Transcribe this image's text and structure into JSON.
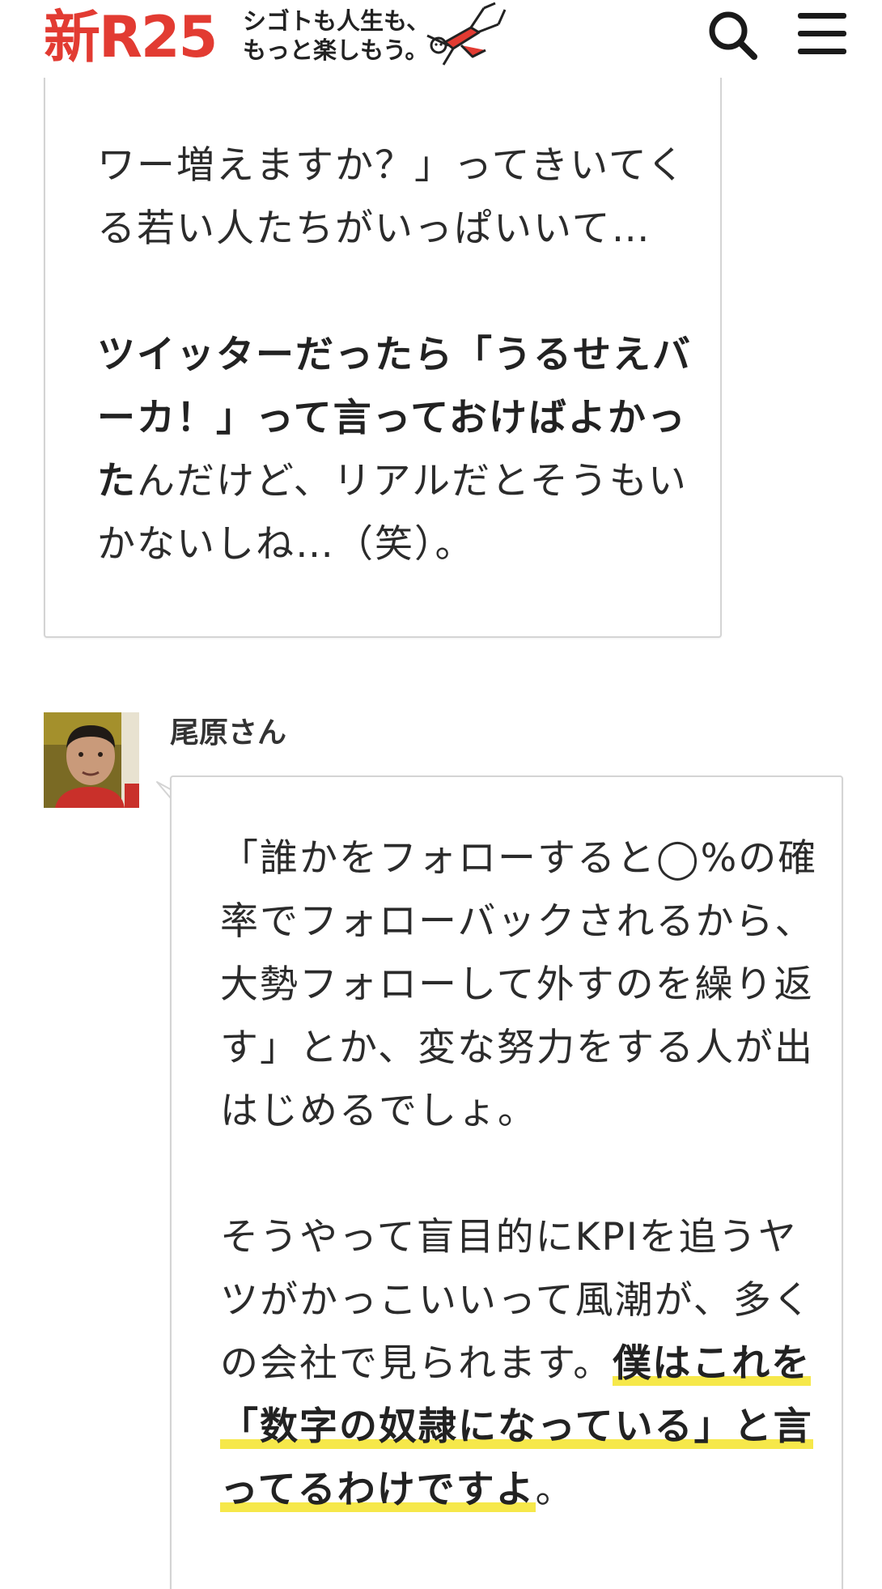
{
  "header": {
    "logo": "新R25",
    "tagline_line1": "シゴトも人生も、",
    "tagline_line2": "もっと楽しもう。",
    "brand_color": "#e23b32",
    "icons": [
      "search-icon",
      "hamburger-menu-icon"
    ]
  },
  "bubble1": {
    "para1": "ワー増えますか？」ってきいてくる若い人たちがいっぱいいて…",
    "para2_bold": "ツイッターだったら「うるせえバーカ！」って言っておけばよかった",
    "para2_rest": "んだけど、リアルだとそうもいかないしね…（笑）。"
  },
  "speaker": {
    "name": "尾原さん"
  },
  "bubble2": {
    "para1": "「誰かをフォローすると◯%の確率でフォローバックされるから、大勢フォローして外すのを繰り返す」とか、変な努力をする人が出はじめるでしょ。",
    "para2_plain": "そうやって盲目的にKPIを追うヤツがかっこいいって風潮が、多くの会社で見られます。",
    "para2_highlight": "僕はこれを「数字の奴隷になっている」と言ってるわけですよ",
    "para2_end": "。",
    "highlight_color": "#f6e84a"
  }
}
